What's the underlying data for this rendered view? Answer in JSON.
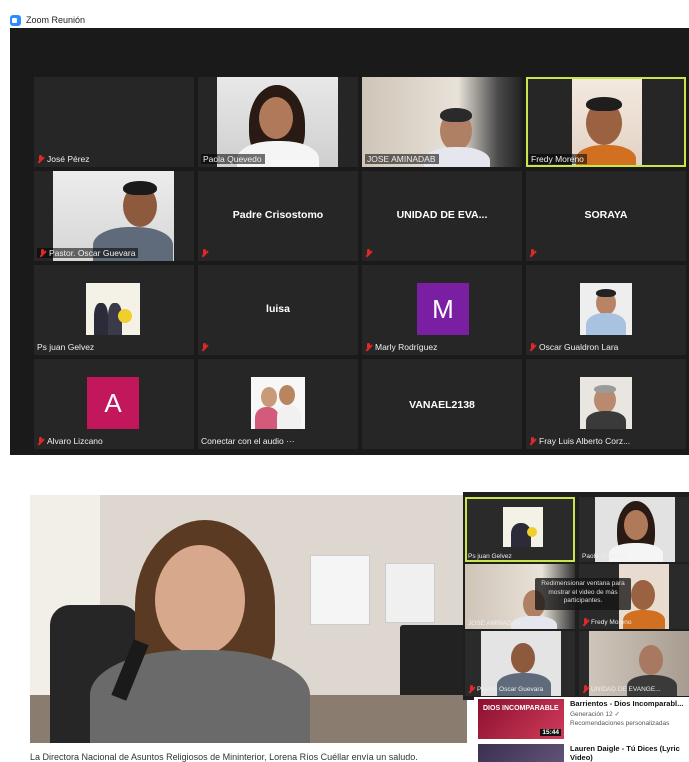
{
  "window": {
    "title": "Zoom Reunión",
    "logo_icon": "zoom-camera-icon",
    "accent_color": "#2d8cff"
  },
  "participants": [
    {
      "name": "José Pérez",
      "muted": true
    },
    {
      "name": "Paola Quevedo",
      "muted": false
    },
    {
      "name": "JOSE AMINADAB",
      "muted": false
    },
    {
      "name": "Fredy Moreno",
      "muted": false,
      "active_speaker": true
    },
    {
      "name": "Pastor. Oscar Guevara",
      "muted": true
    },
    {
      "name": "",
      "display_name": "Padre Crisostomo",
      "muted": true
    },
    {
      "name": "",
      "display_name": "UNIDAD DE EVA...",
      "muted": true
    },
    {
      "name": "",
      "display_name": "SORAYA",
      "muted": true
    },
    {
      "name": "Ps juan Gelvez",
      "muted": false
    },
    {
      "name": "",
      "display_name": "luisa",
      "muted": true
    },
    {
      "name": "Marly Rodríguez",
      "muted": true,
      "avatar_letter": "M",
      "avatar_color": "#7b1fa2"
    },
    {
      "name": "Oscar Gualdron Lara",
      "muted": true
    },
    {
      "name": "Alvaro Lizcano",
      "muted": true,
      "avatar_letter": "A",
      "avatar_color": "#c2185b"
    },
    {
      "name": "Conectar con el audio ···",
      "muted": false
    },
    {
      "name": "",
      "display_name": "VANAEL2138",
      "muted": false
    },
    {
      "name": "Fray Luis Alberto Corz...",
      "muted": true
    }
  ],
  "lower": {
    "video_caption": "La Directora Nacional de Asuntos Religiosos de Mininterior, Lorena Ríos Cuéllar envía un saludo.",
    "mini_participants": [
      {
        "name": "Ps juan Gelvez",
        "muted": false
      },
      {
        "name": "Paola Quevedo",
        "muted": false
      },
      {
        "name": "JOSE AMINADAB",
        "muted": false
      },
      {
        "name": "Fredy Moreno",
        "muted": true
      },
      {
        "name": "Pastor. Oscar Guevara",
        "muted": true
      },
      {
        "name": "UNIDAD DE EVANGE...",
        "muted": true
      }
    ],
    "tooltip": "Redimensionar ventana para mostrar el video de más participantes.",
    "recommendations": [
      {
        "thumb_text": "DIOS INCOMPARABLE",
        "duration": "15:44",
        "title": "Barrientos - Dios Incomparabl...",
        "channel": "Generación 12 ✓",
        "reason": "Recomendaciones personalizadas"
      },
      {
        "title": "Lauren Daigle - Tú Dices (Lyric Video)"
      }
    ]
  }
}
